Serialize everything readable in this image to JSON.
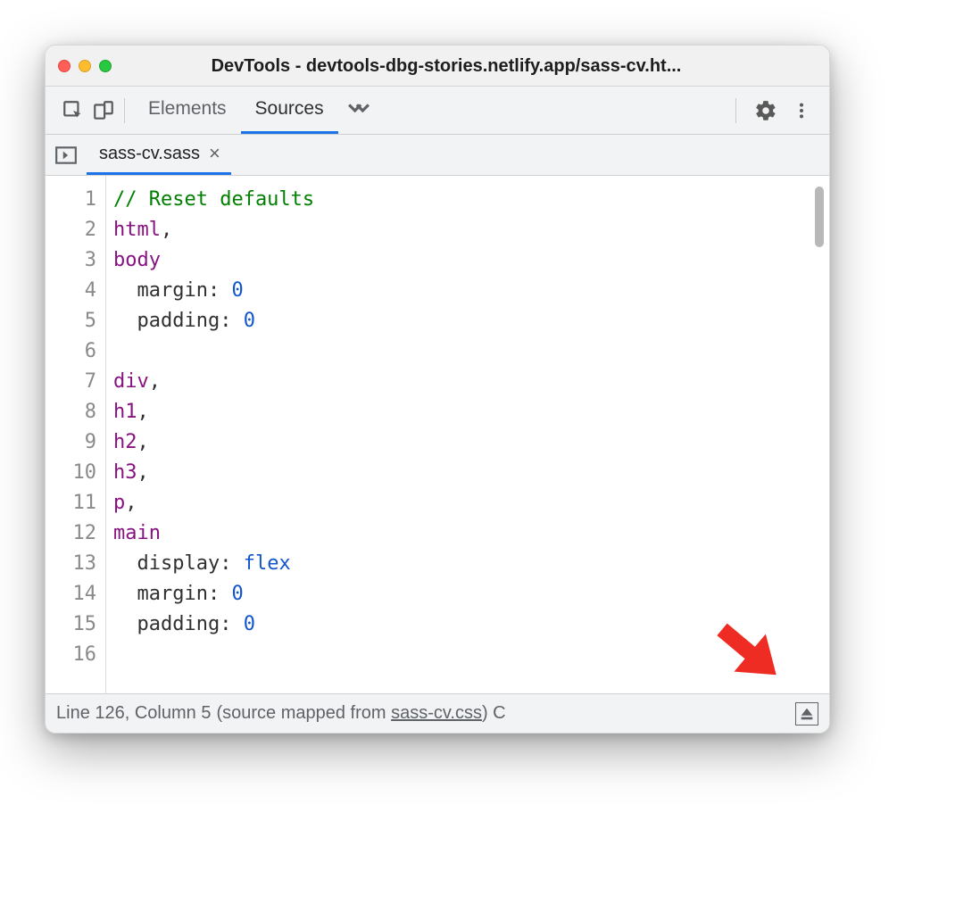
{
  "window": {
    "title": "DevTools - devtools-dbg-stories.netlify.app/sass-cv.ht..."
  },
  "toolbar": {
    "tabs": [
      {
        "label": "Elements",
        "active": false
      },
      {
        "label": "Sources",
        "active": true
      }
    ]
  },
  "filetabs": {
    "active": "sass-cv.sass"
  },
  "code": {
    "lines": [
      {
        "n": 1,
        "tokens": [
          {
            "t": "// Reset defaults",
            "c": "t-comment"
          }
        ]
      },
      {
        "n": 2,
        "tokens": [
          {
            "t": "html",
            "c": "t-sel"
          },
          {
            "t": ",",
            "c": "t-prop"
          }
        ]
      },
      {
        "n": 3,
        "tokens": [
          {
            "t": "body",
            "c": "t-sel"
          }
        ]
      },
      {
        "n": 4,
        "tokens": [
          {
            "t": "  margin",
            "c": "t-prop"
          },
          {
            "t": ": ",
            "c": "t-prop"
          },
          {
            "t": "0",
            "c": "t-val"
          }
        ]
      },
      {
        "n": 5,
        "tokens": [
          {
            "t": "  padding",
            "c": "t-prop"
          },
          {
            "t": ": ",
            "c": "t-prop"
          },
          {
            "t": "0",
            "c": "t-val"
          }
        ]
      },
      {
        "n": 6,
        "tokens": []
      },
      {
        "n": 7,
        "tokens": [
          {
            "t": "div",
            "c": "t-sel"
          },
          {
            "t": ",",
            "c": "t-prop"
          }
        ]
      },
      {
        "n": 8,
        "tokens": [
          {
            "t": "h1",
            "c": "t-sel"
          },
          {
            "t": ",",
            "c": "t-prop"
          }
        ]
      },
      {
        "n": 9,
        "tokens": [
          {
            "t": "h2",
            "c": "t-sel"
          },
          {
            "t": ",",
            "c": "t-prop"
          }
        ]
      },
      {
        "n": 10,
        "tokens": [
          {
            "t": "h3",
            "c": "t-sel"
          },
          {
            "t": ",",
            "c": "t-prop"
          }
        ]
      },
      {
        "n": 11,
        "tokens": [
          {
            "t": "p",
            "c": "t-sel"
          },
          {
            "t": ",",
            "c": "t-prop"
          }
        ]
      },
      {
        "n": 12,
        "tokens": [
          {
            "t": "main",
            "c": "t-sel"
          }
        ]
      },
      {
        "n": 13,
        "tokens": [
          {
            "t": "  display",
            "c": "t-prop"
          },
          {
            "t": ": ",
            "c": "t-prop"
          },
          {
            "t": "flex",
            "c": "t-val"
          }
        ]
      },
      {
        "n": 14,
        "tokens": [
          {
            "t": "  margin",
            "c": "t-prop"
          },
          {
            "t": ": ",
            "c": "t-prop"
          },
          {
            "t": "0",
            "c": "t-val"
          }
        ]
      },
      {
        "n": 15,
        "tokens": [
          {
            "t": "  padding",
            "c": "t-prop"
          },
          {
            "t": ": ",
            "c": "t-prop"
          },
          {
            "t": "0",
            "c": "t-val"
          }
        ]
      },
      {
        "n": 16,
        "tokens": []
      }
    ]
  },
  "status": {
    "position": "Line 126, Column 5",
    "mapped_prefix": "(source mapped from ",
    "mapped_link": "sass-cv.css",
    "mapped_suffix": ")",
    "trail": " C"
  }
}
